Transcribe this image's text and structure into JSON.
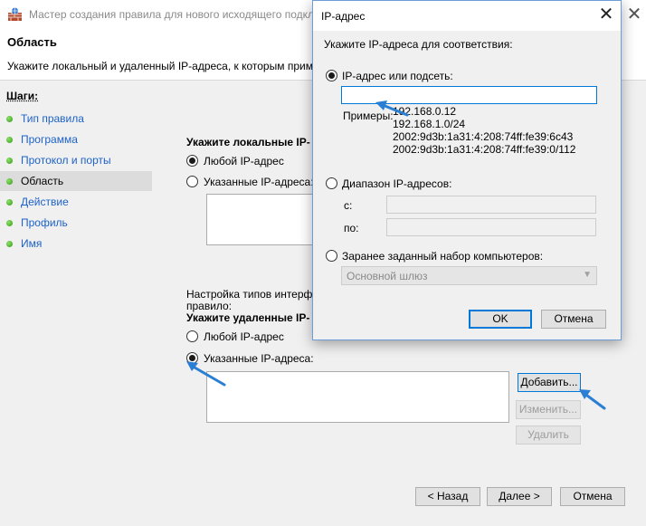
{
  "wizard": {
    "title": "Мастер создания правила для нового исходящего подкл",
    "heading": "Область",
    "subheading": "Укажите локальный и удаленный IP-адреса, к которым применяет",
    "steps_heading": "Шаги:",
    "steps": [
      {
        "label": "Тип правила"
      },
      {
        "label": "Программа"
      },
      {
        "label": "Протокол и порты"
      },
      {
        "label": "Область"
      },
      {
        "label": "Действие"
      },
      {
        "label": "Профиль"
      },
      {
        "label": "Имя"
      }
    ],
    "active_step": "Область",
    "local_heading": "Укажите локальные IP-",
    "local_any": "Любой IP-адрес",
    "local_specified": "Указанные IP-адреса:",
    "interface_text_1": "Настройка типов интерфей",
    "interface_text_2": "правило:",
    "remote_heading": "Укажите удаленные IP-",
    "remote_any": "Любой IP-адрес",
    "remote_specified": "Указанные IP-адреса:",
    "add_button": "Добавить...",
    "edit_button": "Изменить...",
    "delete_button": "Удалить",
    "back_button": "< Назад",
    "next_button": "Далее >",
    "cancel_button": "Отмена",
    "local_selected": "any",
    "remote_selected": "specified"
  },
  "ip_dialog": {
    "title": "IP-адрес",
    "prompt": "Укажите IP-адреса для соответствия:",
    "option_ip": "IP-адрес или подсеть:",
    "ip_value": "",
    "examples_label": "Примеры:",
    "examples": [
      "192.168.0.12",
      "192.168.1.0/24",
      "2002:9d3b:1a31:4:208:74ff:fe39:6c43",
      "2002:9d3b:1a31:4:208:74ff:fe39:0/112"
    ],
    "option_range": "Диапазон IP-адресов:",
    "from_label": "с:",
    "to_label": "по:",
    "option_predefined": "Заранее заданный набор компьютеров:",
    "predefined_value": "Основной шлюз",
    "ok_button": "OK",
    "cancel_button": "Отмена",
    "selected_option": "ip"
  },
  "colors": {
    "accent": "#0078d7",
    "link": "#1d62c7",
    "arrow": "#2a7fd4"
  }
}
